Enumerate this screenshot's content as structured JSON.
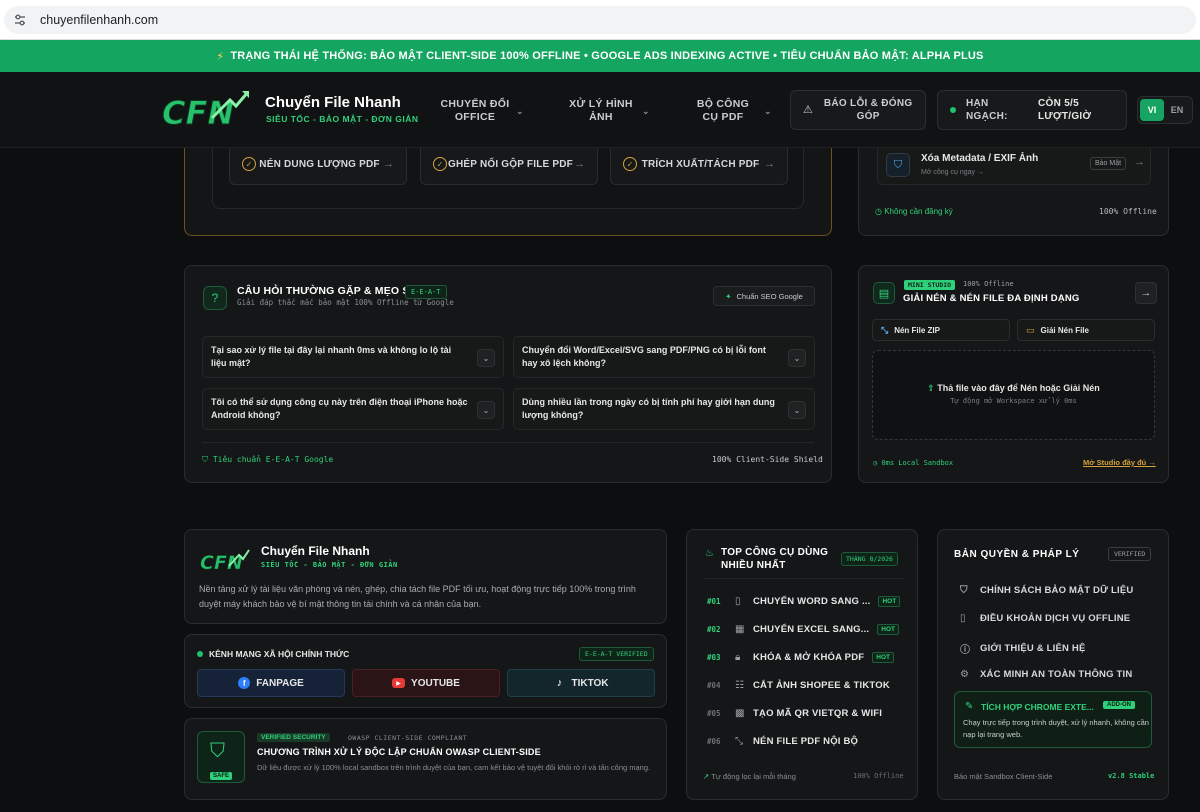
{
  "browser": {
    "url": "chuyenfilenhanh.com"
  },
  "banner": "TRẠNG THÁI HỆ THỐNG: BẢO MẬT CLIENT-SIDE 100% OFFLINE • GOOGLE ADS INDEXING ACTIVE • TIÊU CHUẨN BẢO MẬT: ALPHA PLUS",
  "header": {
    "logo_text": "CFN",
    "brand_name": "Chuyển File Nhanh",
    "brand_tagline": "SIÊU TỐC - BẢO MẬT - ĐƠN GIẢN",
    "nav": [
      {
        "label": "CHUYỂN ĐỔI OFFICE"
      },
      {
        "label": "XỬ LÝ HÌNH ẢNH"
      },
      {
        "label": "BỘ CÔNG CỤ PDF"
      }
    ],
    "report_label": "BÁO LỖI & ĐÓNG GÓP",
    "quota_label": "HẠN NGẠCH:",
    "quota_value": "CÒN 5/5 LƯỢT/GIỜ",
    "lang_vi": "VI",
    "lang_en": "EN"
  },
  "tools_card": {
    "items": [
      {
        "label": "NÉN DUNG LƯỢNG PDF"
      },
      {
        "label": "GHÉP NỐI GỘP FILE PDF"
      },
      {
        "label": "TRÍCH XUẤT/TÁCH PDF"
      }
    ]
  },
  "meta_card": {
    "title": "Xóa Metadata / EXIF Ảnh",
    "subtitle": "Mở công cụ ngay →",
    "tag": "Bảo Mật",
    "footer_left": "Không cần đăng ký",
    "footer_right": "100% Offline"
  },
  "faq": {
    "title": "CÂU HỎI THƯỜNG GẶP & MẸO SEO",
    "badge": "E-E-A-T",
    "subtitle": "Giải đáp thắc mắc bảo mật 100% Offline từ Google",
    "seo_button": "Chuẩn SEO Google",
    "questions": [
      "Tại sao xử lý file tại đây lại nhanh 0ms và không lo lộ tài liệu mật?",
      "Chuyển đổi Word/Excel/SVG sang PDF/PNG có bị lỗi font hay xô lệch không?",
      "Tôi có thể sử dụng công cụ này trên điện thoại iPhone hoặc Android không?",
      "Dùng nhiều lần trong ngày có bị tính phí hay giới hạn dung lượng không?"
    ],
    "footer_left": "Tiêu chuẩn E-E-A-T Google",
    "footer_right": "100% Client-Side Shield"
  },
  "studio": {
    "tag": "MINI STUDIO",
    "offline": "100% Offline",
    "title": "GIẢI NÉN & NÉN FILE ĐA ĐỊNH DẠNG",
    "tab_zip": "Nén File ZIP",
    "tab_unzip": "Giải Nén File",
    "drop_title": "Thả file vào đây để Nén hoặc Giải Nén",
    "drop_sub": "Tự động mở Workspace xử lý 0ms",
    "footer_left": "0ms Local Sandbox",
    "footer_right": "Mở Studio đầy đủ →"
  },
  "footer_brand": {
    "logo_text": "CFN",
    "name": "Chuyển File Nhanh",
    "tagline": "SIÊU TỐC - BẢO MẬT - ĐƠN GIẢN",
    "description": "Nền tảng xử lý tài liệu văn phòng và nén, ghép, chia tách file PDF tối ưu, hoạt động trực tiếp 100% trong trình duyệt máy khách bảo vệ bí mật thông tin tài chính và cá nhân của bạn."
  },
  "social": {
    "title": "KÊNH MẠNG XÃ HỘI CHÍNH THỨC",
    "badge": "E-E-A-T VERIFIED",
    "fanpage": "FANPAGE",
    "youtube": "YOUTUBE",
    "tiktok": "TIKTOK"
  },
  "owasp": {
    "safe": "SAFE",
    "tag": "VERIFIED SECURITY",
    "tag2": "OWASP CLIENT-SIDE COMPLIANT",
    "title": "CHƯƠNG TRÌNH XỬ LÝ ĐỘC LẬP CHUẨN OWASP CLIENT-SIDE",
    "description": "Dữ liệu được xử lý 100% local sandbox trên trình duyệt của bạn, cam kết bảo vệ tuyệt đối khỏi rò rỉ và tấn công mạng."
  },
  "top_tools": {
    "title": "TOP CÔNG CỤ DÙNG NHIỀU NHẤT",
    "month": "THÁNG 8/2026",
    "items": [
      {
        "rank": "#01",
        "name": "CHUYỂN WORD SANG ...",
        "hot": "HOT"
      },
      {
        "rank": "#02",
        "name": "CHUYỂN EXCEL SANG...",
        "hot": "HOT"
      },
      {
        "rank": "#03",
        "name": "KHÓA & MỞ KHÓA PDF",
        "hot": "HOT"
      },
      {
        "rank": "#04",
        "name": "CẮT ẢNH SHOPEE & TIKTOK",
        "hot": ""
      },
      {
        "rank": "#05",
        "name": "TẠO MÃ QR VIETQR & WIFI",
        "hot": ""
      },
      {
        "rank": "#06",
        "name": "NÉN FILE PDF NỘI BỘ",
        "hot": ""
      }
    ],
    "footer_left": "Tự động lọc lại mỗi tháng",
    "footer_right": "100% Offline"
  },
  "legal": {
    "title": "BẢN QUYỀN & PHÁP LÝ",
    "verified": "VERIFIED",
    "items": [
      "CHÍNH SÁCH BẢO MẬT DỮ LIỆU",
      "ĐIỀU KHOẢN DỊCH VỤ OFFLINE",
      "GIỚI THIỆU & LIÊN HỆ",
      "XÁC MINH AN TOÀN THÔNG TIN"
    ],
    "chrome_title": "TÍCH HỢP CHROME EXTE...",
    "chrome_badge": "ADD-ON",
    "chrome_desc": "Chạy trực tiếp trong trình duyệt, xử lý nhanh, không cần nạp lại trang web.",
    "footer_left": "Bảo mật Sandbox Client-Side",
    "footer_right": "v2.8 Stable"
  },
  "colors": {
    "accent": "#2fd07a",
    "banner": "#14a561",
    "warning": "#d6a23a"
  }
}
